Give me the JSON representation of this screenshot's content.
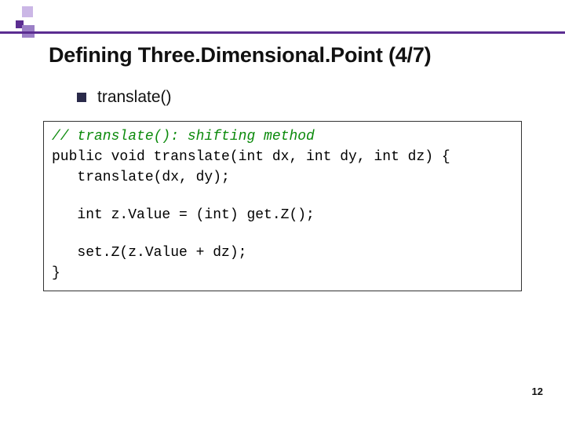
{
  "title": "Defining Three.Dimensional.Point (4/7)",
  "bullet": {
    "text": "translate()"
  },
  "code": {
    "comment": "// translate(): shifting method",
    "line1": "public void translate(int dx, int dy, int dz) {",
    "line2": "   translate(dx, dy);",
    "line3": "   int z.Value = (int) get.Z();",
    "line4": "   set.Z(z.Value + dz);",
    "line5": "}"
  },
  "page": "12"
}
